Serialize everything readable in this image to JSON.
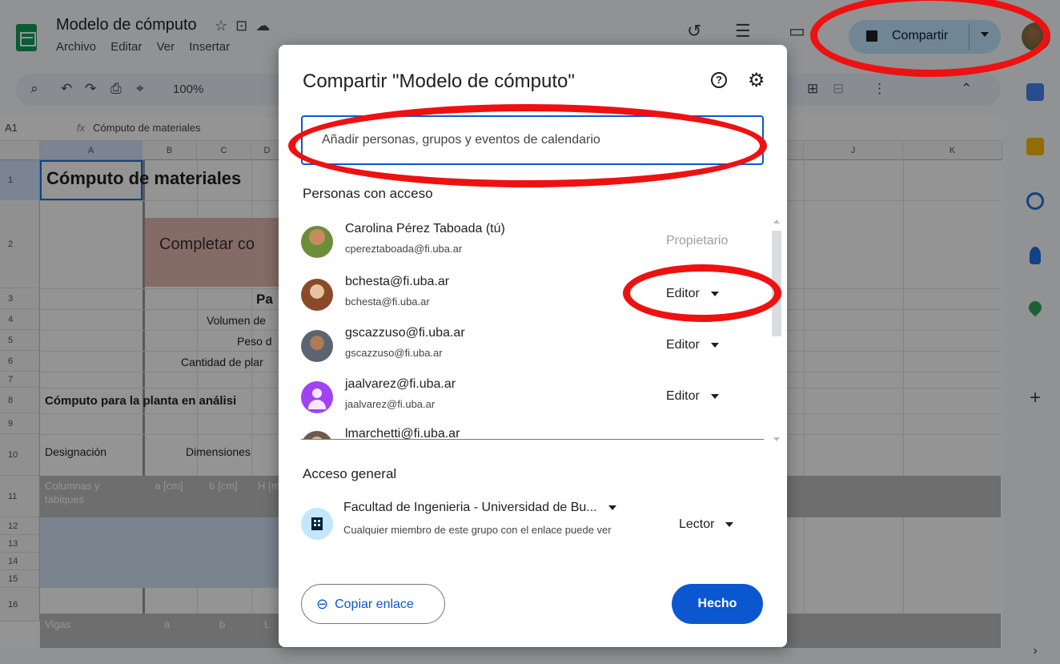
{
  "header": {
    "doc_title": "Modelo de cómputo",
    "title_icons": [
      "star-icon",
      "folder-move-icon",
      "cloud-icon"
    ],
    "menu": [
      "Archivo",
      "Editar",
      "Ver",
      "Insertar"
    ],
    "share_label": "Compartir"
  },
  "toolbar": {
    "zoom": "100%"
  },
  "formula_bar": {
    "cell_ref": "A1",
    "formula": "Cómputo de materiales"
  },
  "grid": {
    "columns": [
      "A",
      "B",
      "C",
      "D",
      "J",
      "K"
    ],
    "rows": [
      "1",
      "2",
      "3",
      "4",
      "5",
      "6",
      "7",
      "8",
      "9",
      "10",
      "11",
      "12",
      "13",
      "14",
      "15",
      "16"
    ],
    "cells": {
      "r1": "Cómputo de materiales",
      "r2": "Completar co",
      "r3": "Pa",
      "r4": "Volumen de",
      "r5": "Peso d",
      "r6": "Cantidad de plar",
      "r8": "Cómputo para la planta en análisi",
      "r10a": "Designación",
      "r10b": "Dimensiones",
      "r11a": "Columnas y tabiques",
      "r11b": "a [cm]",
      "r11c": "b [cm]",
      "r11d": "H [m",
      "r16a": "Vigas",
      "r16b": "a",
      "r16c": "b",
      "r16d": "L"
    }
  },
  "dialog": {
    "title": "Compartir \"Modelo de cómputo\"",
    "add_placeholder": "Añadir personas, grupos y eventos de calendario",
    "people_heading": "Personas con acceso",
    "people": [
      {
        "name": "Carolina Pérez Taboada (tú)",
        "email": "cpereztaboada@fi.uba.ar",
        "role": "Propietario"
      },
      {
        "name": "bchesta@fi.uba.ar",
        "email": "bchesta@fi.uba.ar",
        "role": "Editor"
      },
      {
        "name": "gscazzuso@fi.uba.ar",
        "email": "gscazzuso@fi.uba.ar",
        "role": "Editor"
      },
      {
        "name": "jaalvarez@fi.uba.ar",
        "email": "jaalvarez@fi.uba.ar",
        "role": "Editor"
      },
      {
        "name": "lmarchetti@fi.uba.ar",
        "email": "",
        "role": ""
      }
    ],
    "general_heading": "Acceso general",
    "general_access": {
      "name": "Facultad de Ingenieria - Universidad de Bu...",
      "description": "Cualquier miembro de este grupo con el enlace puede ver",
      "role": "Lector"
    },
    "copy_link_label": "Copiar enlace",
    "done_label": "Hecho"
  },
  "colors": {
    "accent": "#0b57d0",
    "share_bg": "#c2e7ff",
    "annotation": "#ee1111"
  }
}
